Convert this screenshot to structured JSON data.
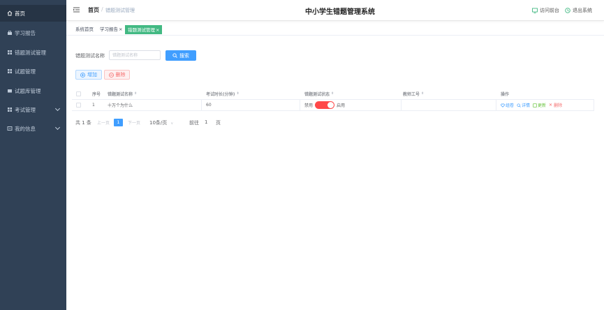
{
  "sidebar": {
    "items": [
      {
        "label": "首页",
        "icon": "home-icon"
      },
      {
        "label": "学习报告",
        "icon": "bag-icon"
      },
      {
        "label": "错题测试管理",
        "icon": "grid-icon"
      },
      {
        "label": "试题管理",
        "icon": "grid-icon"
      },
      {
        "label": "试题库管理",
        "icon": "card-icon"
      },
      {
        "label": "考试管理",
        "icon": "grid-icon",
        "expandable": true
      },
      {
        "label": "我的信息",
        "icon": "card-icon",
        "expandable": true
      }
    ]
  },
  "header": {
    "breadcrumb_home": "首页",
    "breadcrumb_sep": "/",
    "breadcrumb_current": "错题测试管理",
    "title": "中小学生错题管理系统",
    "frontend_label": "访问前台",
    "logout_label": "退出系统"
  },
  "tabs": [
    {
      "label": "系统首页",
      "closable": false
    },
    {
      "label": "学习报告",
      "closable": true
    },
    {
      "label": "错题测试管理",
      "closable": true,
      "active": true
    }
  ],
  "search": {
    "label": "错题测试名称",
    "placeholder": "错题测试名称",
    "button_label": "搜索"
  },
  "actions": {
    "add_label": "增加",
    "delete_label": "删除"
  },
  "table": {
    "columns": [
      "序号",
      "错题测试名称",
      "考试时长(分钟)",
      "错题测试状态",
      "教师工号",
      "操作"
    ],
    "rows": [
      {
        "index": "1",
        "name": "十万个为什么",
        "duration": "60",
        "status_off": "禁用",
        "status_on": "启用",
        "teacher_id": "",
        "ops": [
          "组卷",
          "详情",
          "更新",
          "删除"
        ]
      }
    ]
  },
  "pagination": {
    "total": "共 1 条",
    "prev": "上一页",
    "current_page": "1",
    "next": "下一页",
    "page_size": "10条/页",
    "goto_prefix": "前往",
    "goto_value": "1",
    "goto_suffix": "页"
  },
  "colors": {
    "sidebar_bg": "#304156",
    "primary": "#409eff",
    "active_tag": "#42b983",
    "switch_on": "#ff4949"
  }
}
